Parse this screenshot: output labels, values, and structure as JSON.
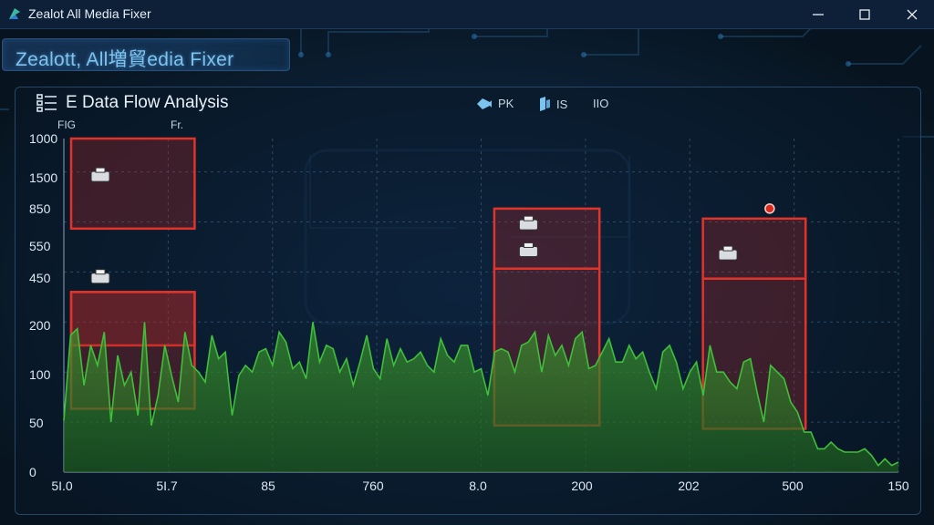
{
  "window": {
    "title": "Zealot All Media Fixer",
    "controls": [
      "minimize",
      "maximize",
      "close"
    ]
  },
  "header": {
    "banner_text": "Zealott, All増貿edia Fixer"
  },
  "panel": {
    "title": "E  Data Flow Analysis",
    "controls": {
      "pk_label": "PK",
      "is_label": "IS",
      "io_label": "IIO"
    },
    "sub_labels": [
      "FIG",
      "Fr."
    ]
  },
  "colors": {
    "accent": "#7cc4ef",
    "series": "#3fbf3a",
    "highlight": "#e0332a",
    "background": "#0a1a2c"
  },
  "chart_data": {
    "type": "area",
    "title": "Data Flow Analysis",
    "y_tick_labels": [
      "1000",
      "1500",
      "850",
      "550",
      "450",
      "200",
      "100",
      "50",
      "0"
    ],
    "x_tick_labels": [
      "5I.0",
      "5I.7",
      "85",
      "760",
      "8.0",
      "200",
      "202",
      "500",
      "150"
    ],
    "grid": true,
    "series": [
      {
        "values": [
          155,
          410,
          430,
          260,
          380,
          320,
          420,
          150,
          350,
          260,
          300,
          170,
          450,
          140,
          230,
          380,
          290,
          210,
          420,
          320,
          300,
          270,
          410,
          340,
          360,
          170,
          290,
          320,
          300,
          360,
          370,
          320,
          420,
          390,
          310,
          330,
          280,
          450,
          330,
          380,
          370,
          300,
          340,
          260,
          330,
          410,
          310,
          280,
          400,
          320,
          370,
          330,
          340,
          360,
          320,
          300,
          400,
          350,
          330,
          380,
          380,
          300,
          310,
          230,
          360,
          370,
          360,
          300,
          380,
          390,
          420,
          300,
          410,
          350,
          380,
          320,
          400,
          420,
          310,
          320,
          360,
          400,
          330,
          330,
          380,
          340,
          360,
          300,
          250,
          360,
          380,
          330,
          250,
          300,
          330,
          230,
          380,
          300,
          300,
          270,
          250,
          330,
          340,
          240,
          150,
          320,
          300,
          280,
          210,
          180,
          120,
          120,
          70,
          70,
          90,
          70,
          60,
          60,
          60,
          70,
          50,
          20,
          40,
          20,
          30
        ]
      }
    ],
    "highlights": [
      {
        "x_range": [
          0.0,
          0.148
        ],
        "y_range": [
          730,
          1000
        ]
      },
      {
        "x_range": [
          0.0,
          0.148
        ],
        "y_range": [
          380,
          540
        ]
      },
      {
        "x_range": [
          0.0,
          0.148
        ],
        "y_range": [
          190,
          540
        ]
      },
      {
        "x_range": [
          0.507,
          0.633
        ],
        "y_range": [
          610,
          790
        ]
      },
      {
        "x_range": [
          0.507,
          0.633
        ],
        "y_range": [
          140,
          610
        ]
      },
      {
        "x_range": [
          0.757,
          0.88
        ],
        "y_range": [
          580,
          760
        ]
      },
      {
        "x_range": [
          0.757,
          0.88
        ],
        "y_range": [
          130,
          580
        ]
      }
    ],
    "markers": [
      {
        "x": 0.035,
        "y": 885
      },
      {
        "x": 0.035,
        "y": 580
      },
      {
        "x": 0.548,
        "y": 740
      },
      {
        "x": 0.548,
        "y": 660
      },
      {
        "x": 0.787,
        "y": 650
      },
      {
        "x": 0.837,
        "y": 790
      }
    ]
  }
}
